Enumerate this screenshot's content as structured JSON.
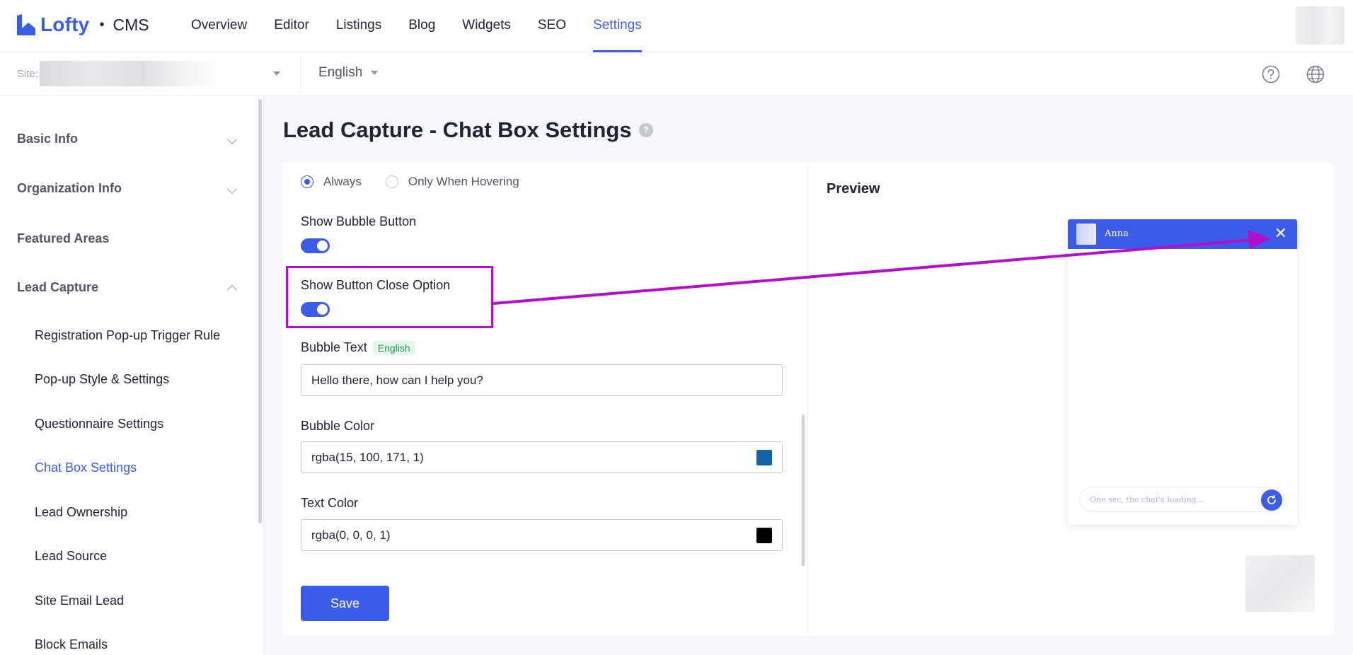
{
  "brand": {
    "name": "Lofty",
    "separator": "•",
    "product": "CMS"
  },
  "nav": {
    "items": [
      {
        "label": "Overview"
      },
      {
        "label": "Editor"
      },
      {
        "label": "Listings"
      },
      {
        "label": "Blog"
      },
      {
        "label": "Widgets"
      },
      {
        "label": "SEO"
      },
      {
        "label": "Settings",
        "active": true
      }
    ]
  },
  "subbar": {
    "site_label": "Site:",
    "language": "English"
  },
  "sidebar": {
    "groups": [
      {
        "label": "Basic Info",
        "expanded": false
      },
      {
        "label": "Organization Info",
        "expanded": false
      },
      {
        "label": "Featured Areas"
      },
      {
        "label": "Lead Capture",
        "expanded": true
      }
    ],
    "sub_items": [
      {
        "label": "Registration Pop-up Trigger Rule"
      },
      {
        "label": "Pop-up Style & Settings"
      },
      {
        "label": "Questionnaire Settings"
      },
      {
        "label": "Chat Box Settings",
        "active": true
      },
      {
        "label": "Lead Ownership"
      },
      {
        "label": "Lead Source"
      },
      {
        "label": "Site Email Lead"
      },
      {
        "label": "Block Emails"
      }
    ]
  },
  "page": {
    "title": "Lead Capture - Chat Box Settings",
    "help": "?"
  },
  "form": {
    "display_options": [
      {
        "label": "Always",
        "selected": true
      },
      {
        "label": "Only When Hovering",
        "selected": false
      }
    ],
    "show_bubble_button": {
      "label": "Show Bubble Button",
      "on": true
    },
    "show_close_option": {
      "label": "Show Button Close Option",
      "on": true
    },
    "bubble_text": {
      "label": "Bubble Text",
      "tag": "English",
      "value": "Hello there, how can I help you?"
    },
    "bubble_color": {
      "label": "Bubble Color",
      "value": "rgba(15, 100, 171, 1)",
      "swatch": "#0f64ab"
    },
    "text_color": {
      "label": "Text Color",
      "value": "rgba(0, 0, 0, 1)",
      "swatch": "#000000"
    },
    "save_label": "Save"
  },
  "preview": {
    "title": "Preview",
    "agent_name": "Anna",
    "close_glyph": "✕",
    "input_placeholder": "One sec, the chat's loading..."
  },
  "colors": {
    "accent": "#3b5ce6",
    "annotation": "#b10fc9"
  }
}
